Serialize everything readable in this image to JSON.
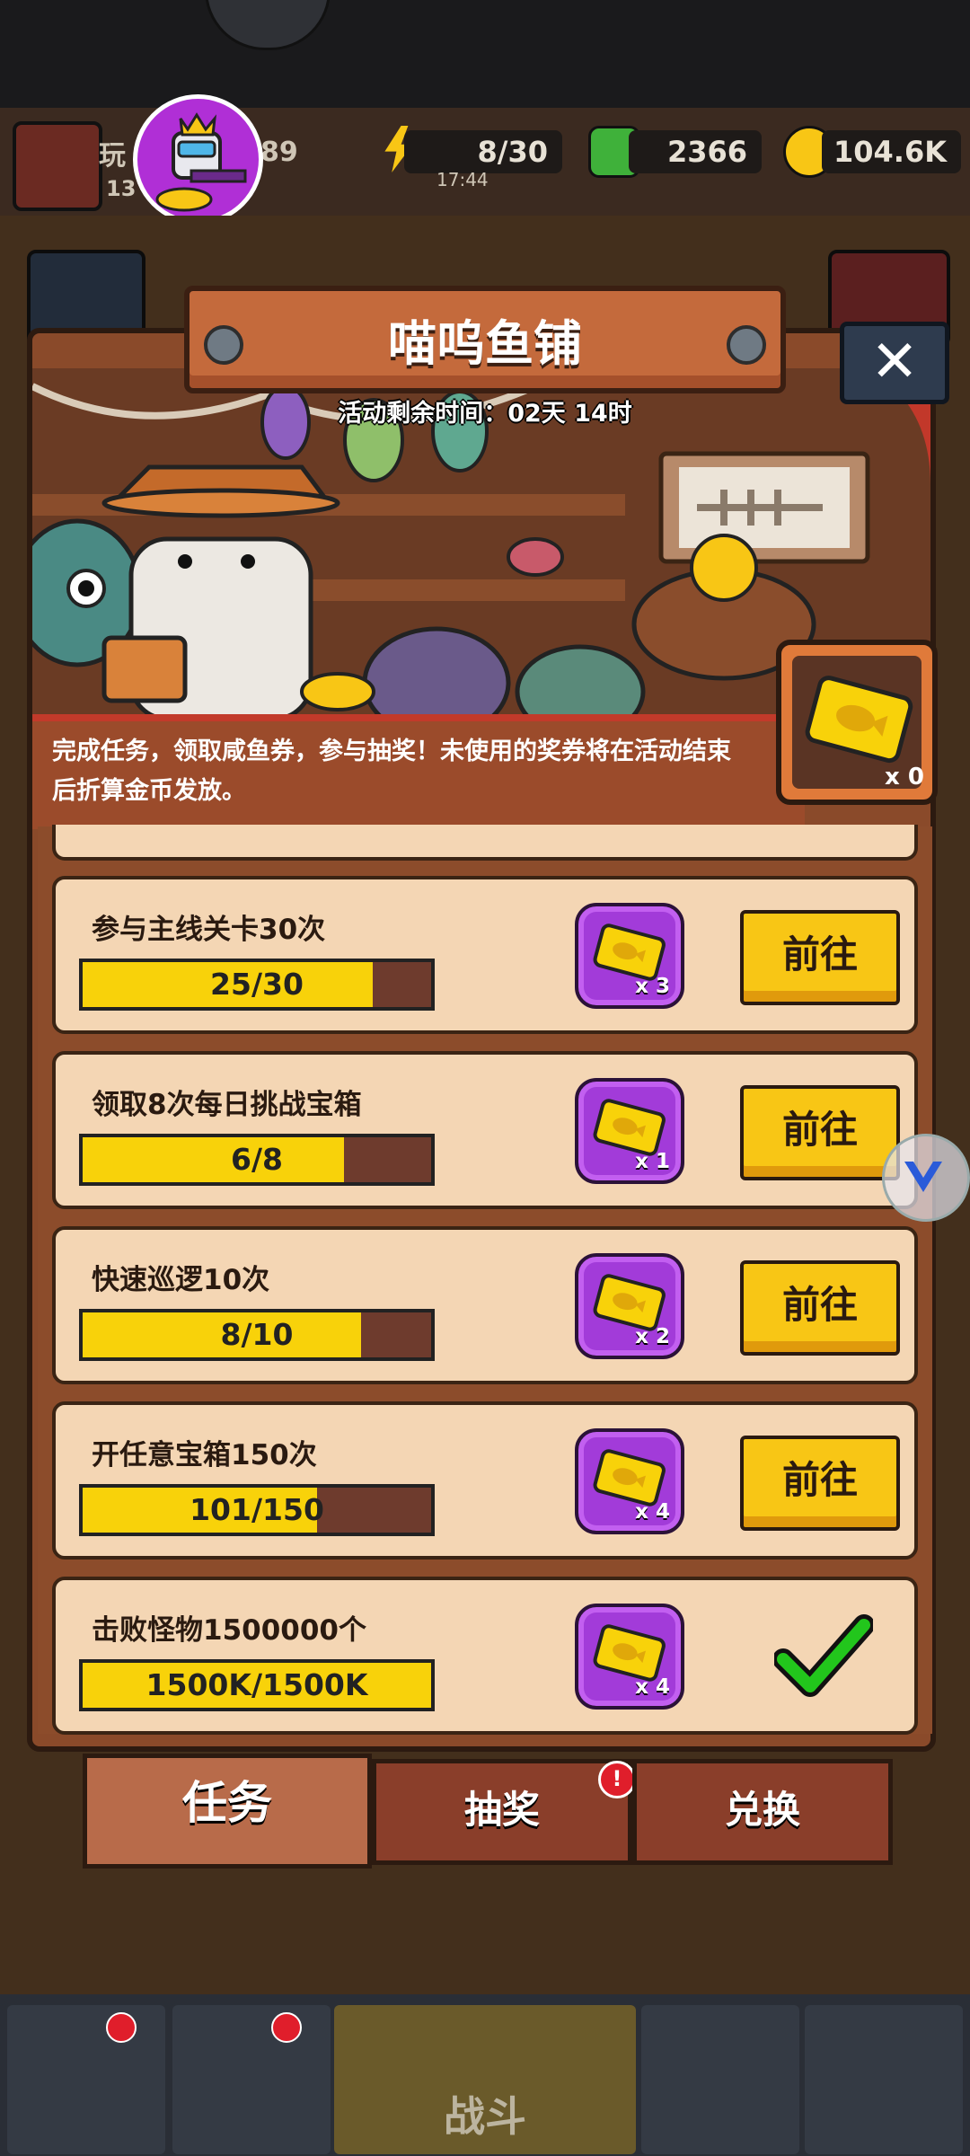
{
  "header": {
    "energy": "8/30",
    "energy_timer": "17:44",
    "gems": "2366",
    "coins": "104.6K",
    "player_name": "玩",
    "player_level": "13",
    "player_extra": "89"
  },
  "dialog": {
    "title": "喵呜鱼铺",
    "subtitle": "活动剩余时间：02天 14时",
    "close_label": "✕",
    "description": "完成任务，领取咸鱼券，参与抽奖！未使用的奖券将在活动结束后折算金币发放。",
    "ticket_count": "x 0"
  },
  "tasks": [
    {
      "title": "参与主线关卡30次",
      "progress_text": "25/30",
      "progress": 0.8333,
      "reward": "x 3",
      "action": "前往",
      "done": false
    },
    {
      "title": "领取8次每日挑战宝箱",
      "progress_text": "6/8",
      "progress": 0.75,
      "reward": "x 1",
      "action": "前往",
      "done": false
    },
    {
      "title": "快速巡逻10次",
      "progress_text": "8/10",
      "progress": 0.8,
      "reward": "x 2",
      "action": "前往",
      "done": false
    },
    {
      "title": "开任意宝箱150次",
      "progress_text": "101/150",
      "progress": 0.6733,
      "reward": "x 4",
      "action": "前往",
      "done": false
    },
    {
      "title": "击败怪物1500000个",
      "progress_text": "1500K/1500K",
      "progress": 1.0,
      "reward": "x 4",
      "action": "",
      "done": true
    }
  ],
  "tabs": [
    {
      "label": "任务",
      "active": true
    },
    {
      "label": "抽奖",
      "active": false,
      "badge": "!"
    },
    {
      "label": "兑换",
      "active": false
    }
  ],
  "bottom_nav": {
    "battle_label": "战斗"
  },
  "colors": {
    "progress_fill": "#f8d20a",
    "button_yellow": "#f8c615",
    "reward_purple": "#a23bd9",
    "check_green": "#22c61c"
  }
}
